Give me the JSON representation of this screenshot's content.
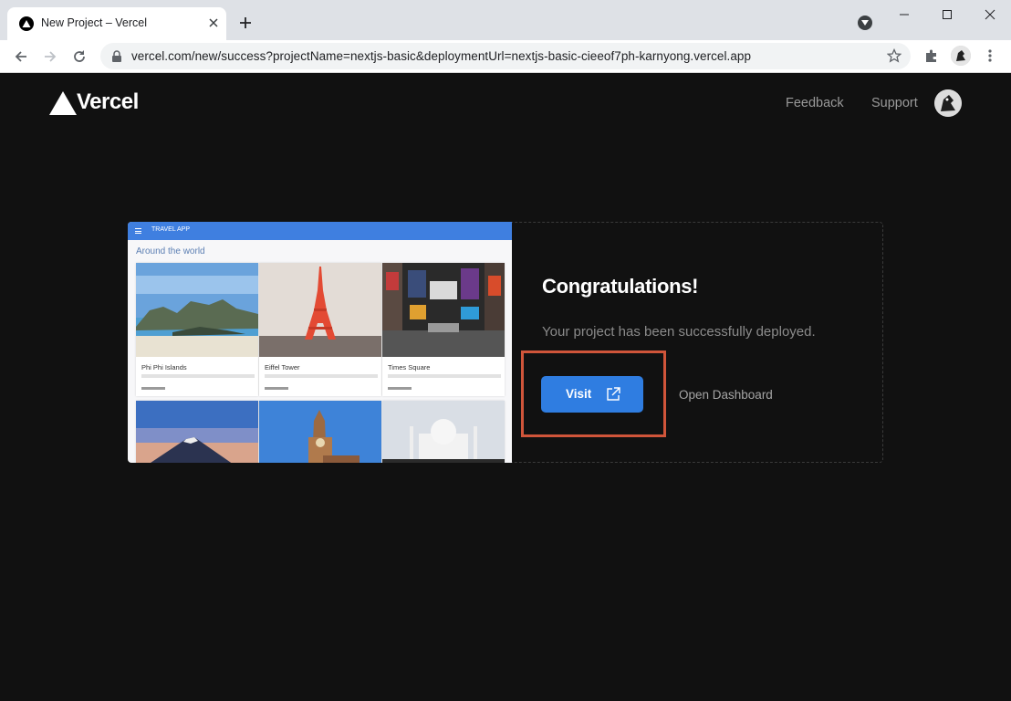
{
  "browser": {
    "tab_title": "New Project – Vercel",
    "url": "vercel.com/new/success?projectName=nextjs-basic&deploymentUrl=nextjs-basic-cieeof7ph-karnyong.vercel.app"
  },
  "header": {
    "logo_text": "Vercel",
    "feedback_label": "Feedback",
    "support_label": "Support"
  },
  "preview": {
    "app_title": "TRAVEL APP",
    "section_title": "Around the world",
    "tiles": [
      {
        "title": "Phi Phi Islands"
      },
      {
        "title": "Eiffel Tower"
      },
      {
        "title": "Times Square"
      }
    ]
  },
  "success": {
    "heading": "Congratulations!",
    "message": "Your project has been successfully deployed.",
    "visit_label": "Visit",
    "dashboard_label": "Open Dashboard"
  },
  "colors": {
    "accent": "#2f7de1",
    "highlight": "#d0553a",
    "background": "#111111"
  }
}
